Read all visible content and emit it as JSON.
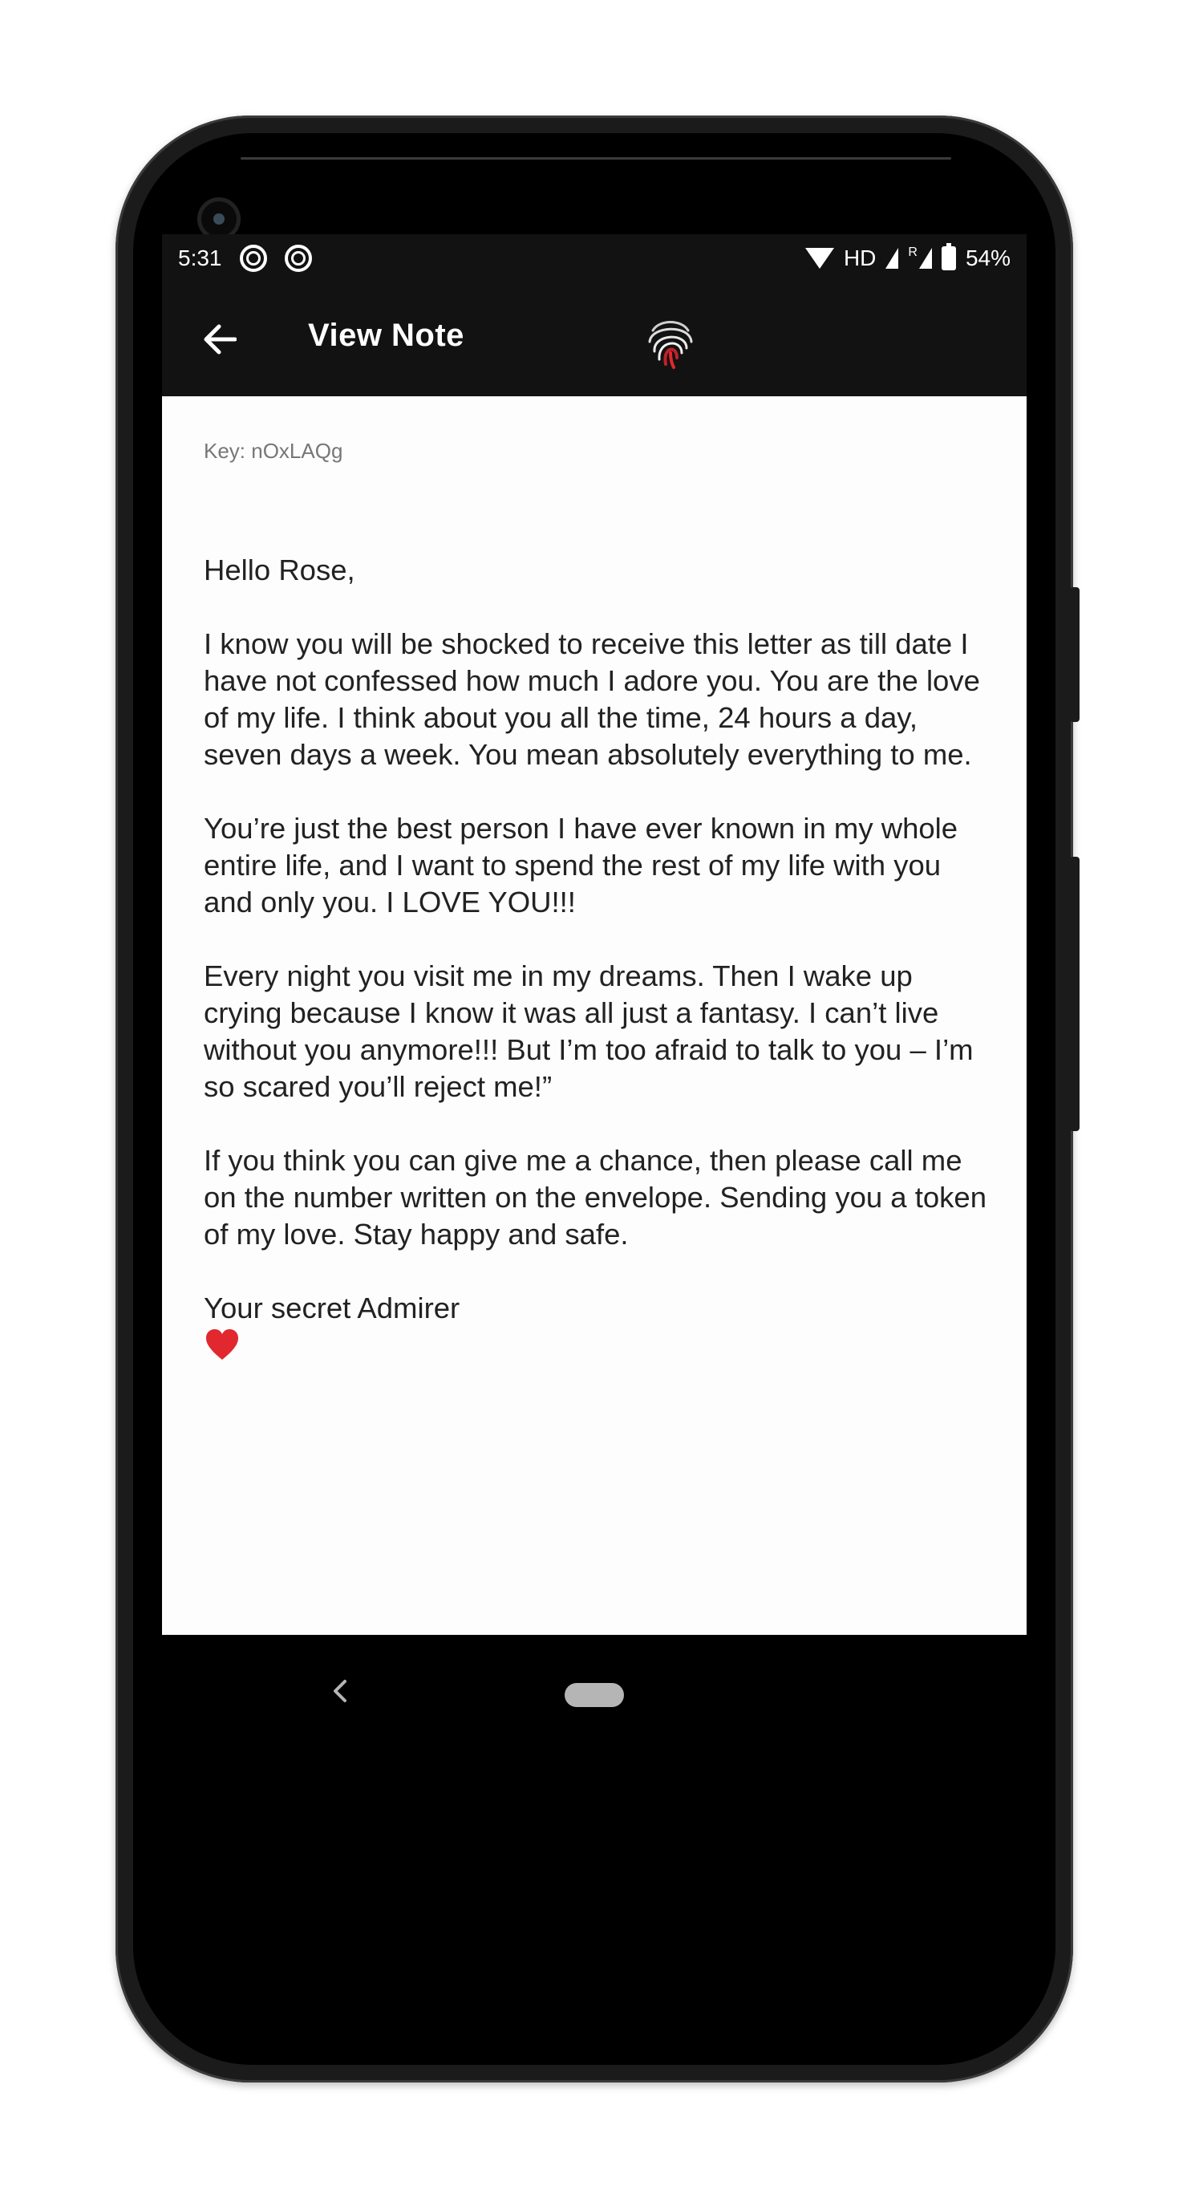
{
  "status_bar": {
    "time": "5:31",
    "network_label": "HD",
    "roaming_label": "R",
    "battery_percent": "54%"
  },
  "app_bar": {
    "title": "View Note",
    "logo_icon": "fingerprint-icon",
    "back_icon": "arrow-left-icon"
  },
  "note": {
    "key": "Key: nOxLAQg",
    "greeting": "Hello Rose,",
    "paragraphs": [
      "I know you will be shocked to receive this letter as till date I have not confessed how much I adore you. You are the love of my life. I think about you all the time, 24 hours a day, seven days a week. You mean absolutely everything to me.",
      "You’re just the best person I have ever known in my whole entire life, and I want to spend the rest of my life with you and only you. I LOVE YOU!!!",
      "Every night you visit me in my dreams. Then I wake up crying because I know it was all just a fantasy. I can’t live without you anymore!!! But I’m too afraid to talk to you – I’m so scared you’ll reject me!”",
      "If you think you can give me a chance, then please call me on the number written on the envelope. Sending you a token of my love. Stay happy and safe."
    ],
    "signature": "Your secret Admirer",
    "signature_icon": "heart-icon"
  },
  "nav_bar": {
    "back_icon": "chevron-left-icon",
    "home_icon": "home-pill-icon"
  },
  "colors": {
    "app_bar": "#121212",
    "background": "#fdfdfd",
    "heart": "#e0282e",
    "fingerprint_accent": "#c0202a"
  }
}
